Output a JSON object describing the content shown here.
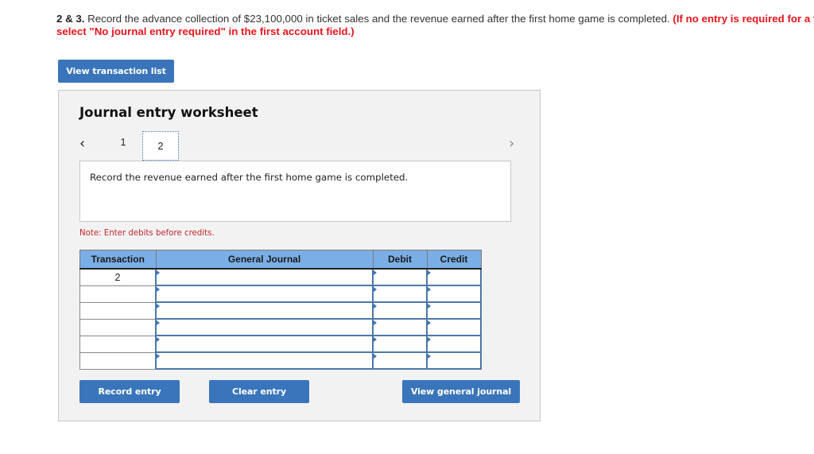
{
  "question": {
    "number": "2 & 3.",
    "text": " Record the advance collection of $23,100,000 in ticket sales and the revenue earned after the first home game is completed. ",
    "instruction_line1": "(If no entry is required for a transa",
    "instruction_line2": "select \"No journal entry required\" in the first account field.)"
  },
  "buttons": {
    "view_transaction_list": "View transaction list",
    "record_entry": "Record entry",
    "clear_entry": "Clear entry",
    "view_general_journal": "View general journal"
  },
  "worksheet": {
    "title": "Journal entry worksheet",
    "nav_prev_icon": "‹",
    "nav_next_icon": "›",
    "tabs": [
      {
        "label": "1",
        "active": false
      },
      {
        "label": "2",
        "active": true
      }
    ],
    "description": "Record the revenue earned after the first home game is completed.",
    "note": "Note: Enter debits before credits."
  },
  "journal_table": {
    "headers": [
      "Transaction",
      "General Journal",
      "Debit",
      "Credit"
    ],
    "rows": [
      {
        "transaction": "2",
        "account": "",
        "debit": "",
        "credit": ""
      },
      {
        "transaction": "",
        "account": "",
        "debit": "",
        "credit": ""
      },
      {
        "transaction": "",
        "account": "",
        "debit": "",
        "credit": ""
      },
      {
        "transaction": "",
        "account": "",
        "debit": "",
        "credit": ""
      },
      {
        "transaction": "",
        "account": "",
        "debit": "",
        "credit": ""
      },
      {
        "transaction": "",
        "account": "",
        "debit": "",
        "credit": ""
      }
    ]
  },
  "colors": {
    "button_blue": "#3a75bb",
    "header_blue": "#7aaee6",
    "instruction_red": "#e8141c",
    "note_red": "#c0282d"
  }
}
